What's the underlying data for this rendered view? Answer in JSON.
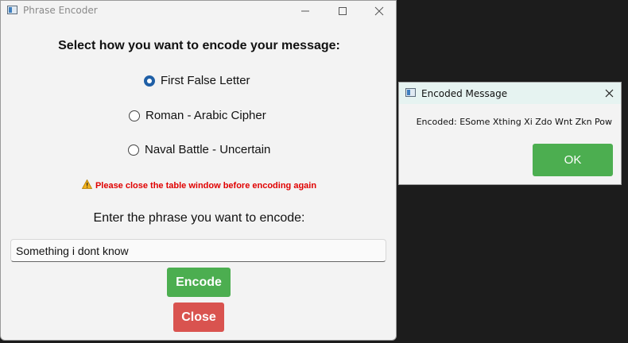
{
  "main_window": {
    "title": "Phrase Encoder",
    "heading": "Select how you want to encode your message:",
    "options": [
      {
        "label": "First False Letter",
        "selected": true
      },
      {
        "label": "Roman - Arabic Cipher",
        "selected": false
      },
      {
        "label": "Naval Battle - Uncertain",
        "selected": false
      }
    ],
    "warning": "Please close the table window before encoding again",
    "prompt": "Enter the phrase you want to encode:",
    "phrase_value": "Something i dont know",
    "encode_label": "Encode",
    "close_label": "Close"
  },
  "dialog": {
    "title": "Encoded Message",
    "message": "Encoded: ESome Xthing Xi Zdo Wnt Zkn Pow",
    "ok_label": "OK"
  },
  "colors": {
    "accent_green": "#4cae50",
    "danger_red": "#d9534f",
    "warning_text": "#e00000",
    "radio_selected": "#1f5fa6"
  }
}
